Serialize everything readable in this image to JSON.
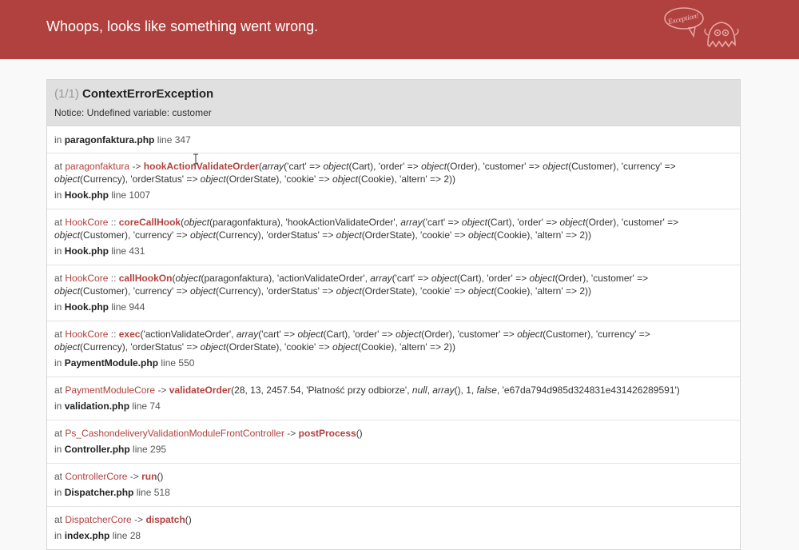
{
  "header": {
    "title": "Whoops, looks like something went wrong.",
    "logo_text": "Exception!",
    "background": "#b0413e"
  },
  "exception": {
    "count": "(1/1)",
    "name": "ContextErrorException",
    "message": "Notice: Undefined variable: customer"
  },
  "trace": [
    {
      "kind": "origin",
      "file": "paragonfaktura.php",
      "line": "line 347"
    },
    {
      "class": "paragonfaktura",
      "type": "->",
      "function": "hookActionValidateOrder",
      "args_html": "(<em>array</em>('cart' => <em>object</em>(Cart), 'order' => <em>object</em>(Order), 'customer' => <em>object</em>(Customer), 'currency' => <em>object</em>(Currency), 'orderStatus' => <em>object</em>(OrderState), 'cookie' => <em>object</em>(Cookie), 'altern' => 2))",
      "file": "Hook.php",
      "line": "line 1007"
    },
    {
      "class": "HookCore",
      "type": "::",
      "function": "coreCallHook",
      "args_html": "(<em>object</em>(paragonfaktura), 'hookActionValidateOrder', <em>array</em>('cart' => <em>object</em>(Cart), 'order' => <em>object</em>(Order), 'customer' => <em>object</em>(Customer), 'currency' => <em>object</em>(Currency), 'orderStatus' => <em>object</em>(OrderState), 'cookie' => <em>object</em>(Cookie), 'altern' => 2))",
      "file": "Hook.php",
      "line": "line 431"
    },
    {
      "class": "HookCore",
      "type": "::",
      "function": "callHookOn",
      "args_html": "(<em>object</em>(paragonfaktura), 'actionValidateOrder', <em>array</em>('cart' => <em>object</em>(Cart), 'order' => <em>object</em>(Order), 'customer' => <em>object</em>(Customer), 'currency' => <em>object</em>(Currency), 'orderStatus' => <em>object</em>(OrderState), 'cookie' => <em>object</em>(Cookie), 'altern' => 2))",
      "file": "Hook.php",
      "line": "line 944"
    },
    {
      "class": "HookCore",
      "type": "::",
      "function": "exec",
      "args_html": "('actionValidateOrder', <em>array</em>('cart' => <em>object</em>(Cart), 'order' => <em>object</em>(Order), 'customer' => <em>object</em>(Customer), 'currency' => <em>object</em>(Currency), 'orderStatus' => <em>object</em>(OrderState), 'cookie' => <em>object</em>(Cookie), 'altern' => 2))",
      "file": "PaymentModule.php",
      "line": "line 550"
    },
    {
      "class": "PaymentModuleCore",
      "type": "->",
      "function": "validateOrder",
      "args_html": "(28, 13, 2457.54, 'Płatność przy odbiorze', <em>null</em>, <em>array</em>(), 1, <em>false</em>, 'e67da794d985d324831e431426289591')",
      "file": "validation.php",
      "line": "line 74"
    },
    {
      "class": "Ps_CashondeliveryValidationModuleFrontController",
      "type": "->",
      "function": "postProcess",
      "args_html": "()",
      "file": "Controller.php",
      "line": "line 295"
    },
    {
      "class": "ControllerCore",
      "type": "->",
      "function": "run",
      "args_html": "()",
      "file": "Dispatcher.php",
      "line": "line 518"
    },
    {
      "class": "DispatcherCore",
      "type": "->",
      "function": "dispatch",
      "args_html": "()",
      "file": "index.php",
      "line": "line 28"
    }
  ],
  "labels": {
    "at": "at",
    "in": "in"
  }
}
